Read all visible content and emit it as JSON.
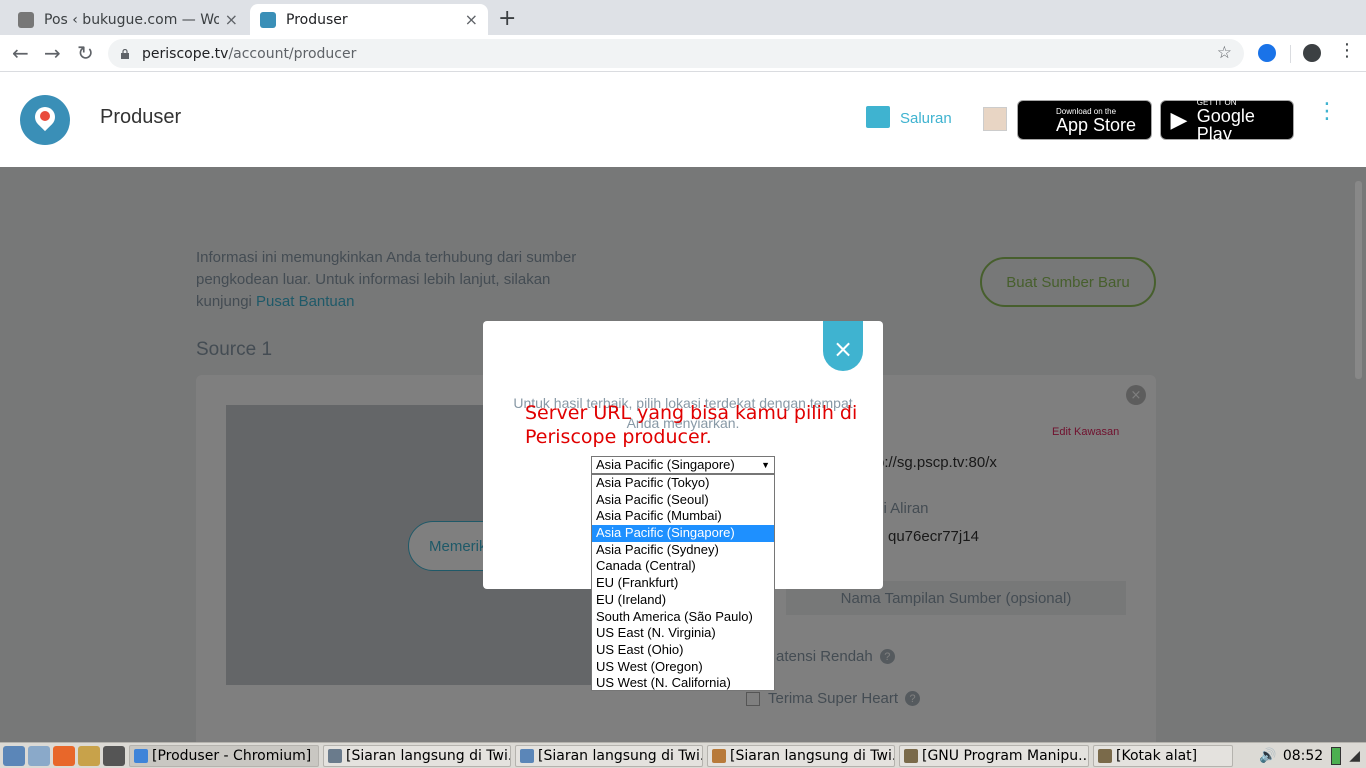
{
  "browser": {
    "tabs": [
      {
        "title": "Pos ‹ bukugue.com — Wo",
        "close": "×",
        "active": false
      },
      {
        "title": "Produser",
        "close": "×",
        "active": true
      }
    ],
    "new_tab": "+",
    "url_host": "periscope.tv",
    "url_path": "/account/producer",
    "star": "☆"
  },
  "header": {
    "title": "Produser",
    "channels_label": "Saluran",
    "app_store": {
      "small": "Download on the",
      "big": "App Store"
    },
    "google_play": {
      "small": "GET IT ON",
      "big": "Google Play"
    },
    "menu": "⋮"
  },
  "page": {
    "info_text": "Informasi ini memungkinkan Anda terhubung dari sumber pengkodean luar. Untuk informasi lebih lanjut, silakan kunjungi ",
    "help_link": "Pusat Bantuan",
    "new_source_button": "Buat Sumber Baru",
    "source_title": "Source 1",
    "check_button": "Memeriksa",
    "edit_region": "Edit Kawasan",
    "server_url": "p://sg.pscp.tv:80/x",
    "stream_key_label": "ci Aliran",
    "stream_key": "qu76ecr77j14",
    "name_placeholder": "Nama Tampilan Sumber (opsional)",
    "low_latency": "atensi Rendah",
    "super_heart": "Terima Super Heart",
    "card_close": "×"
  },
  "modal": {
    "close": "×",
    "help_text": "Untuk hasil terbaik, pilih lokasi terdekat dengan tempat Anda menyiarkan.",
    "annotation": "Server URL yang bisa kamu pilih di Periscope producer.",
    "selected_region": "Asia Pacific (Singapore)",
    "regions": [
      "Asia Pacific (Tokyo)",
      "Asia Pacific (Seoul)",
      "Asia Pacific (Mumbai)",
      "Asia Pacific (Singapore)",
      "Asia Pacific (Sydney)",
      "Canada (Central)",
      "EU (Frankfurt)",
      "EU (Ireland)",
      "South America (São Paulo)",
      "US East (N. Virginia)",
      "US East (Ohio)",
      "US West (Oregon)",
      "US West (N. California)"
    ],
    "selected_index": 3
  },
  "taskbar": {
    "tasks": [
      {
        "label": "[Produser - Chromium]",
        "active": true
      },
      {
        "label": "[Siaran langsung di Twi...",
        "active": false
      },
      {
        "label": "[Siaran langsung di Twi...",
        "active": false
      },
      {
        "label": "[Siaran langsung di Twi...",
        "active": false
      },
      {
        "label": "[GNU Program Manipu...",
        "active": false
      },
      {
        "label": "[Kotak alat]",
        "active": false
      }
    ],
    "clock": "08:52"
  },
  "colors": {
    "accent": "#3fb3d0",
    "annotation": "#e00000",
    "highlight": "#1e90ff",
    "green_button": "#8fbf5a"
  }
}
